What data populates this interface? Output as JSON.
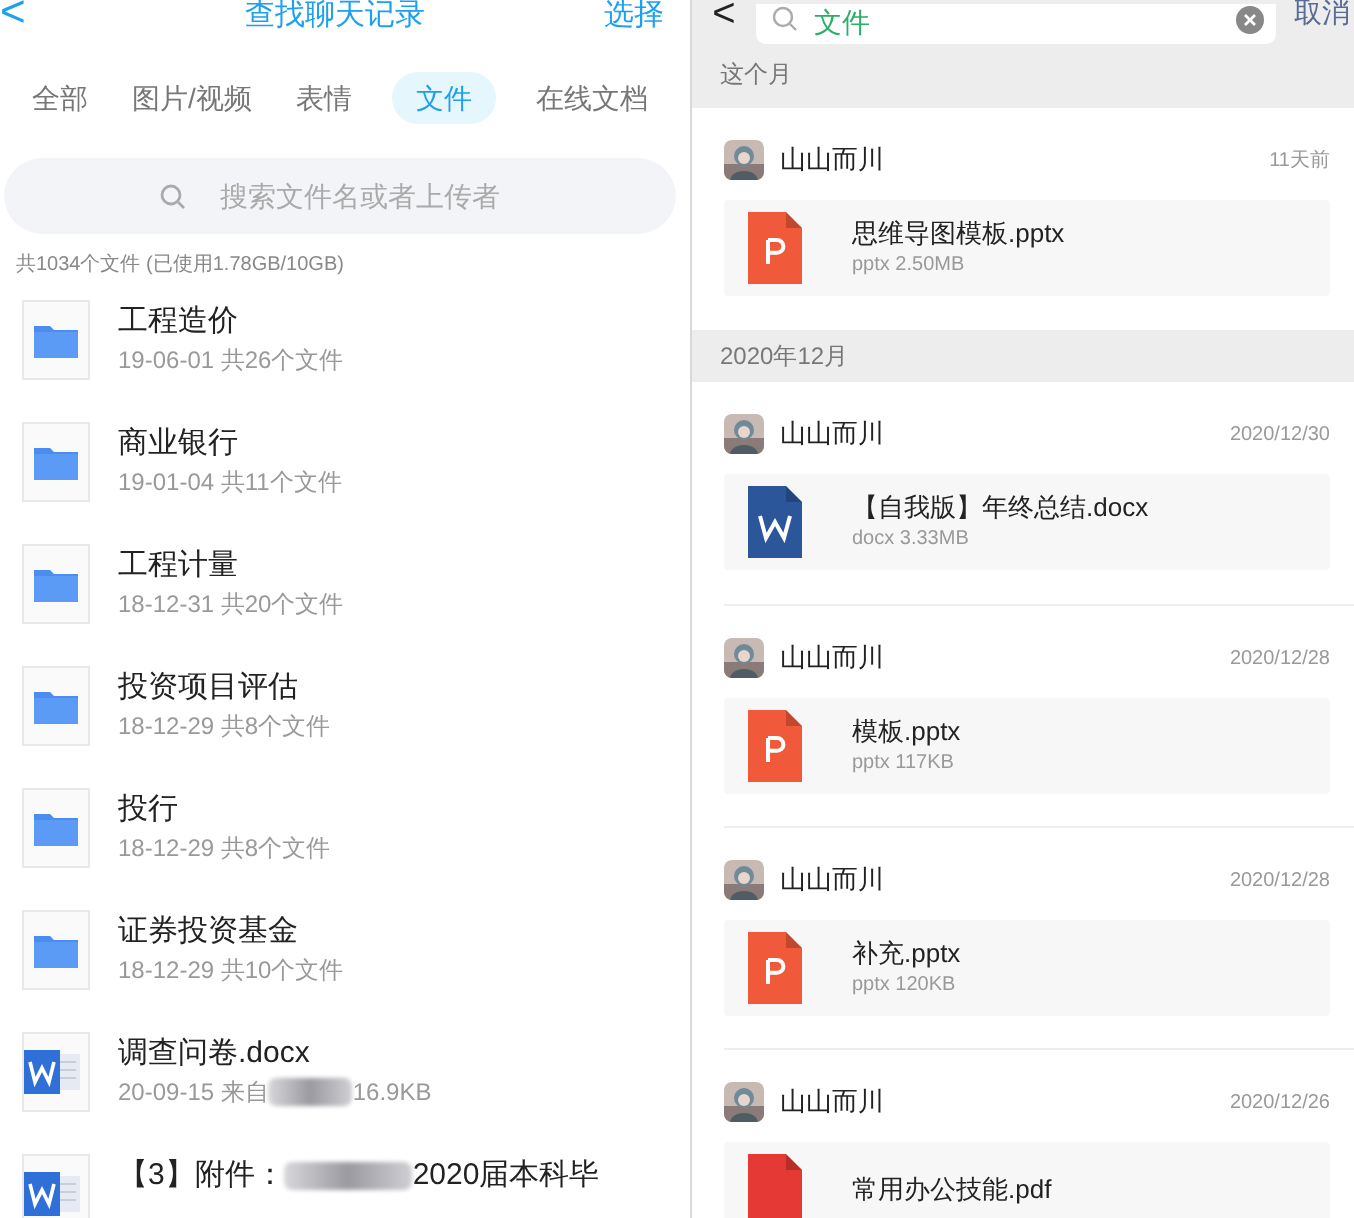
{
  "left": {
    "header": {
      "back": "<",
      "title": "查找聊天记录",
      "action": "选择"
    },
    "tabs": [
      {
        "label": "全部",
        "selected": false
      },
      {
        "label": "图片/视频",
        "selected": false
      },
      {
        "label": "表情",
        "selected": false
      },
      {
        "label": "文件",
        "selected": true
      },
      {
        "label": "在线文档",
        "selected": false
      }
    ],
    "search": {
      "placeholder": "搜索文件名或者上传者"
    },
    "summary": "共1034个文件 (已使用1.78GB/10GB)",
    "files": [
      {
        "kind": "folder",
        "name": "工程造价",
        "meta": "19-06-01 共26个文件"
      },
      {
        "kind": "folder",
        "name": "商业银行",
        "meta": "19-01-04 共11个文件"
      },
      {
        "kind": "folder",
        "name": "工程计量",
        "meta": "18-12-31 共20个文件"
      },
      {
        "kind": "folder",
        "name": "投资项目评估",
        "meta": "18-12-29 共8个文件"
      },
      {
        "kind": "folder",
        "name": "投行",
        "meta": "18-12-29 共8个文件"
      },
      {
        "kind": "folder",
        "name": "证券投资基金",
        "meta": "18-12-29 共10个文件"
      },
      {
        "kind": "word",
        "name": "调查问卷.docx",
        "meta": "20-09-15 来自",
        "meta_after": "16.9KB",
        "redacted": true
      },
      {
        "kind": "word",
        "name": "【3】附件：",
        "name_after": "2020届本科毕",
        "redacted": true
      }
    ]
  },
  "right": {
    "search": {
      "back": "<",
      "value": "文件",
      "cancel": "取消"
    },
    "sections": [
      {
        "title": "这个月",
        "items": [
          {
            "sender": "山山而川",
            "time": "11天前",
            "kind": "pptx",
            "file": "思维导图模板.pptx",
            "meta": "pptx 2.50MB"
          }
        ]
      },
      {
        "title": "2020年12月",
        "items": [
          {
            "sender": "山山而川",
            "time": "2020/12/30",
            "kind": "docx",
            "file": "【自我版】年终总结.docx",
            "meta": "docx 3.33MB"
          },
          {
            "sender": "山山而川",
            "time": "2020/12/28",
            "kind": "pptx",
            "file": "模板.pptx",
            "meta": "pptx 117KB"
          },
          {
            "sender": "山山而川",
            "time": "2020/12/28",
            "kind": "pptx",
            "file": "补充.pptx",
            "meta": "pptx 120KB"
          },
          {
            "sender": "山山而川",
            "time": "2020/12/26",
            "kind": "pdf",
            "file": "常用办公技能.pdf"
          }
        ]
      }
    ]
  }
}
